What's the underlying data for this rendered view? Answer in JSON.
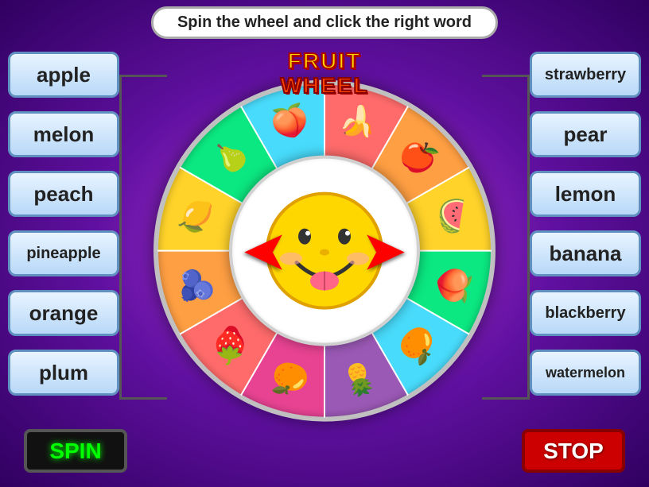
{
  "title": "Spin the wheel and click the right word",
  "wheel_title_line1": "FRUIT",
  "wheel_title_line2": "WHEEL",
  "left_words": [
    {
      "id": "apple",
      "label": "apple"
    },
    {
      "id": "melon",
      "label": "melon"
    },
    {
      "id": "peach",
      "label": "peach"
    },
    {
      "id": "pineapple",
      "label": "pineapple"
    },
    {
      "id": "orange",
      "label": "orange"
    },
    {
      "id": "plum",
      "label": "plum"
    }
  ],
  "right_words": [
    {
      "id": "strawberry",
      "label": "strawberry"
    },
    {
      "id": "pear",
      "label": "pear"
    },
    {
      "id": "lemon",
      "label": "lemon"
    },
    {
      "id": "banana",
      "label": "banana"
    },
    {
      "id": "blackberry",
      "label": "blackberry"
    },
    {
      "id": "watermelon",
      "label": "watermelon"
    }
  ],
  "spin_label": "SPIN",
  "stop_label": "STOP",
  "fruits": [
    {
      "emoji": "🍌",
      "angle": 15
    },
    {
      "emoji": "🍎",
      "angle": 45
    },
    {
      "emoji": "🍉",
      "angle": 75
    },
    {
      "emoji": "🍑",
      "angle": 105
    },
    {
      "emoji": "🍊",
      "angle": 135
    },
    {
      "emoji": "🍍",
      "angle": 165
    },
    {
      "emoji": "🍊",
      "angle": 195
    },
    {
      "emoji": "🍓",
      "angle": 225
    },
    {
      "emoji": "🫐",
      "angle": 255
    },
    {
      "emoji": "🍋",
      "angle": 285
    },
    {
      "emoji": "🍐",
      "angle": 315
    },
    {
      "emoji": "🍑",
      "angle": 345
    }
  ]
}
